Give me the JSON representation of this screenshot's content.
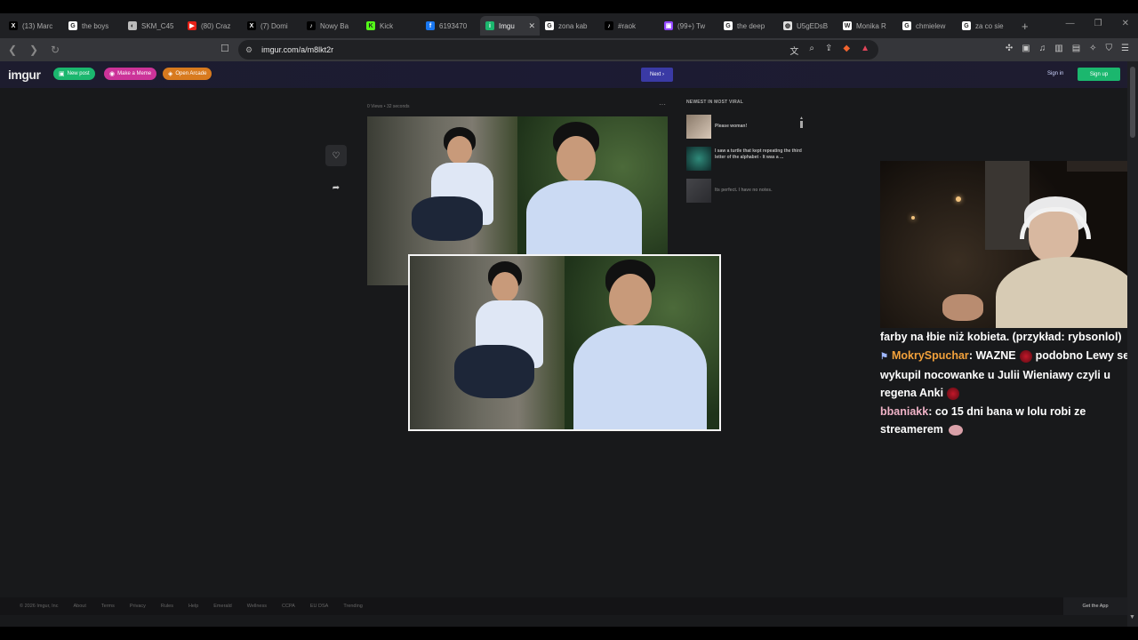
{
  "browser": {
    "tabs": [
      {
        "label": "(13) Marc",
        "icon": "x-logo-icon",
        "color": "#000000",
        "glyph": "X"
      },
      {
        "label": "the boys",
        "icon": "google-icon",
        "color": "#ffffff",
        "glyph": "G"
      },
      {
        "label": "SKM_C45",
        "icon": "document-icon",
        "color": "#bbbbbb",
        "glyph": "◐"
      },
      {
        "label": "(80) Craz",
        "icon": "youtube-icon",
        "color": "#e62117",
        "glyph": "▶"
      },
      {
        "label": "(7) Domi",
        "icon": "x-logo-icon",
        "color": "#000000",
        "glyph": "X"
      },
      {
        "label": "Nowy Ba",
        "icon": "tiktok-icon",
        "color": "#000000",
        "glyph": "♪"
      },
      {
        "label": "Kick",
        "icon": "kick-icon",
        "color": "#53fc18",
        "glyph": "K"
      },
      {
        "label": "6193470",
        "icon": "facebook-icon",
        "color": "#1877f2",
        "glyph": "f"
      },
      {
        "label": "Imgu",
        "icon": "imgur-icon",
        "color": "#1bb76e",
        "glyph": "i",
        "active": true
      },
      {
        "label": "zona kab",
        "icon": "google-icon",
        "color": "#ffffff",
        "glyph": "G"
      },
      {
        "label": "#raok",
        "icon": "tiktok-icon",
        "color": "#000000",
        "glyph": "♪"
      },
      {
        "label": "(99+) Tw",
        "icon": "twitch-icon",
        "color": "#9146ff",
        "glyph": "▣"
      },
      {
        "label": "the deep",
        "icon": "google-icon",
        "color": "#ffffff",
        "glyph": "G"
      },
      {
        "label": "U5gEDsB",
        "icon": "globe-icon",
        "color": "#dddddd",
        "glyph": "◍"
      },
      {
        "label": "Monika R",
        "icon": "wikipedia-icon",
        "color": "#ffffff",
        "glyph": "W"
      },
      {
        "label": "chmielew",
        "icon": "google-icon",
        "color": "#ffffff",
        "glyph": "G"
      },
      {
        "label": "za co sie",
        "icon": "google-icon",
        "color": "#ffffff",
        "glyph": "G"
      }
    ],
    "url": "imgur.com/a/m8lkt2r",
    "new_tab": "+"
  },
  "imgur": {
    "logo": "imgur",
    "new_post": "New post",
    "make_meme": "Make a Meme",
    "open_arcade": "Open Arcade",
    "next": "Next",
    "sign_in": "Sign in",
    "sign_up": "Sign up",
    "post_meta": "0 Views • 32 seconds",
    "more": "···",
    "viral_title": "NEWEST IN MOST VIRAL",
    "viral_items": [
      {
        "title": "Please woman!"
      },
      {
        "title": "I saw a turtle that kept repeating the third letter of the alphabet - It was a ..."
      },
      {
        "title": "Its perfect. I have no notes."
      }
    ],
    "footer": [
      "© 2026 Imgur, Inc",
      "About",
      "Terms",
      "Privacy",
      "Rules",
      "Help",
      "Emerald",
      "Wellness",
      "CCPA",
      "EU DSA",
      "Trending"
    ],
    "get_app": "Get the App"
  },
  "chat": {
    "line1": "farby na łbie niż kobieta. (przykład: rybsonlol)",
    "line2_user": "MokrySpuchar",
    "line2_a": ": WAZNE",
    "line2_b": "podobno Lewy se wykupil nocowanke u Julii Wieniawy czyli u regena Anki",
    "line3_user": "bbaniakk",
    "line3_text": ": co 15 dni bana w lolu robi ze streamerem"
  },
  "colors": {
    "signup": "#1bb76e",
    "next": "#3a3aa5",
    "new_post": "#1bb76e",
    "make_meme": "#cc3399",
    "open_arcade": "#d87a1e"
  }
}
